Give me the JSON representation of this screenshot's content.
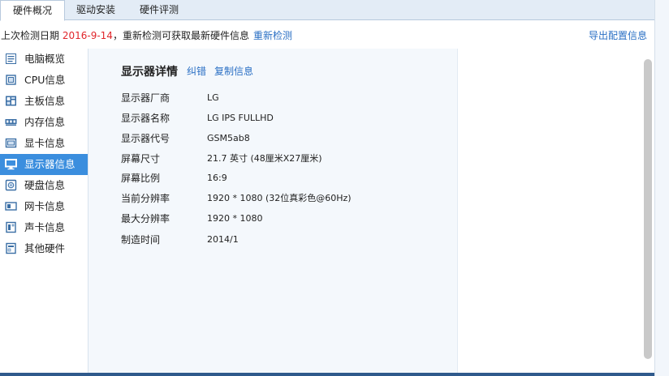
{
  "tabs": [
    {
      "label": "硬件概况"
    },
    {
      "label": "驱动安装"
    },
    {
      "label": "硬件评测"
    }
  ],
  "infobar": {
    "prefix": "上次检测日期 ",
    "date": "2016-9-14",
    "suffix": "，重新检测可获取最新硬件信息",
    "recheck": "重新检测",
    "export": "导出配置信息"
  },
  "sidebar": {
    "items": [
      {
        "label": "电脑概览",
        "icon": "computer-icon"
      },
      {
        "label": "CPU信息",
        "icon": "cpu-icon"
      },
      {
        "label": "主板信息",
        "icon": "motherboard-icon"
      },
      {
        "label": "内存信息",
        "icon": "memory-icon"
      },
      {
        "label": "显卡信息",
        "icon": "graphics-card-icon"
      },
      {
        "label": "显示器信息",
        "icon": "monitor-icon"
      },
      {
        "label": "硬盘信息",
        "icon": "harddisk-icon"
      },
      {
        "label": "网卡信息",
        "icon": "network-card-icon"
      },
      {
        "label": "声卡信息",
        "icon": "sound-card-icon"
      },
      {
        "label": "其他硬件",
        "icon": "other-hardware-icon"
      }
    ],
    "active_index": 5
  },
  "detail": {
    "title": "显示器详情",
    "correct": "纠错",
    "copy": "复制信息",
    "rows": [
      {
        "key": "显示器厂商",
        "value": "LG"
      },
      {
        "key": "显示器名称",
        "value": "LG IPS FULLHD"
      },
      {
        "key": "显示器代号",
        "value": "GSM5ab8"
      },
      {
        "key": "屏幕尺寸",
        "value": "21.7 英寸 (48厘米X27厘米)"
      },
      {
        "key": "屏幕比例",
        "value": "16:9"
      },
      {
        "key": "当前分辨率",
        "value": "1920 * 1080 (32位真彩色@60Hz)"
      },
      {
        "key": "最大分辨率",
        "value": "1920 * 1080"
      },
      {
        "key": "制造时间",
        "value": "2014/1"
      }
    ]
  },
  "colors": {
    "accent": "#3b8ede",
    "link": "#2a6fc4",
    "date": "#e0262b",
    "panel_bg": "#f4f8fc"
  }
}
